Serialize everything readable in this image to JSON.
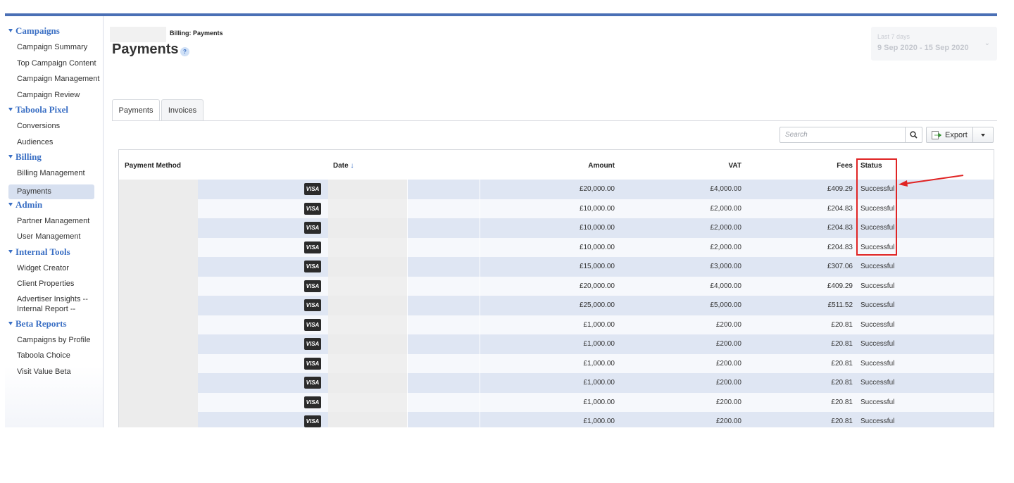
{
  "sidebar": {
    "groups": [
      {
        "title": "Campaigns",
        "items": [
          "Campaign Summary",
          "Top Campaign Content",
          "Campaign Management",
          "Campaign Review"
        ]
      },
      {
        "title": "Taboola Pixel",
        "items": [
          "Conversions",
          "Audiences"
        ]
      },
      {
        "title": "Billing",
        "items": [
          "Billing Management",
          "Payments"
        ]
      },
      {
        "title": "Admin",
        "items": [
          "Partner Management",
          "User Management"
        ]
      },
      {
        "title": "Internal Tools",
        "items": [
          "Widget Creator",
          "Client Properties",
          "Advertiser Insights -- Internal Report --"
        ]
      },
      {
        "title": "Beta Reports",
        "items": [
          "Campaigns by Profile",
          "Taboola Choice",
          "Visit Value Beta"
        ]
      }
    ],
    "active_item": "Payments"
  },
  "header": {
    "breadcrumb": "Billing: Payments",
    "title": "Payments",
    "help_label": "?"
  },
  "daterange": {
    "label": "Last 7 days",
    "value": "9 Sep 2020 - 15 Sep 2020"
  },
  "tabs": [
    {
      "label": "Payments",
      "active": true
    },
    {
      "label": "Invoices",
      "active": false
    }
  ],
  "search": {
    "placeholder": "Search"
  },
  "export": {
    "label": "Export"
  },
  "table": {
    "columns": {
      "method": "Payment Method",
      "date": "Date",
      "amount": "Amount",
      "vat": "VAT",
      "fees": "Fees",
      "status": "Status"
    },
    "card_label": "VISA",
    "rows": [
      {
        "amount": "£20,000.00",
        "vat": "£4,000.00",
        "fees": "£409.29",
        "status": "Successful"
      },
      {
        "amount": "£10,000.00",
        "vat": "£2,000.00",
        "fees": "£204.83",
        "status": "Successful"
      },
      {
        "amount": "£10,000.00",
        "vat": "£2,000.00",
        "fees": "£204.83",
        "status": "Successful"
      },
      {
        "amount": "£10,000.00",
        "vat": "£2,000.00",
        "fees": "£204.83",
        "status": "Successful"
      },
      {
        "amount": "£15,000.00",
        "vat": "£3,000.00",
        "fees": "£307.06",
        "status": "Successful"
      },
      {
        "amount": "£20,000.00",
        "vat": "£4,000.00",
        "fees": "£409.29",
        "status": "Successful"
      },
      {
        "amount": "£25,000.00",
        "vat": "£5,000.00",
        "fees": "£511.52",
        "status": "Successful"
      },
      {
        "amount": "£1,000.00",
        "vat": "£200.00",
        "fees": "£20.81",
        "status": "Successful"
      },
      {
        "amount": "£1,000.00",
        "vat": "£200.00",
        "fees": "£20.81",
        "status": "Successful"
      },
      {
        "amount": "£1,000.00",
        "vat": "£200.00",
        "fees": "£20.81",
        "status": "Successful"
      },
      {
        "amount": "£1,000.00",
        "vat": "£200.00",
        "fees": "£20.81",
        "status": "Successful"
      },
      {
        "amount": "£1,000.00",
        "vat": "£200.00",
        "fees": "£20.81",
        "status": "Successful"
      },
      {
        "amount": "£1,000.00",
        "vat": "£200.00",
        "fees": "£20.81",
        "status": "Successful"
      }
    ]
  },
  "colors": {
    "accent": "#3a6fc4",
    "annotation": "#e02424"
  }
}
